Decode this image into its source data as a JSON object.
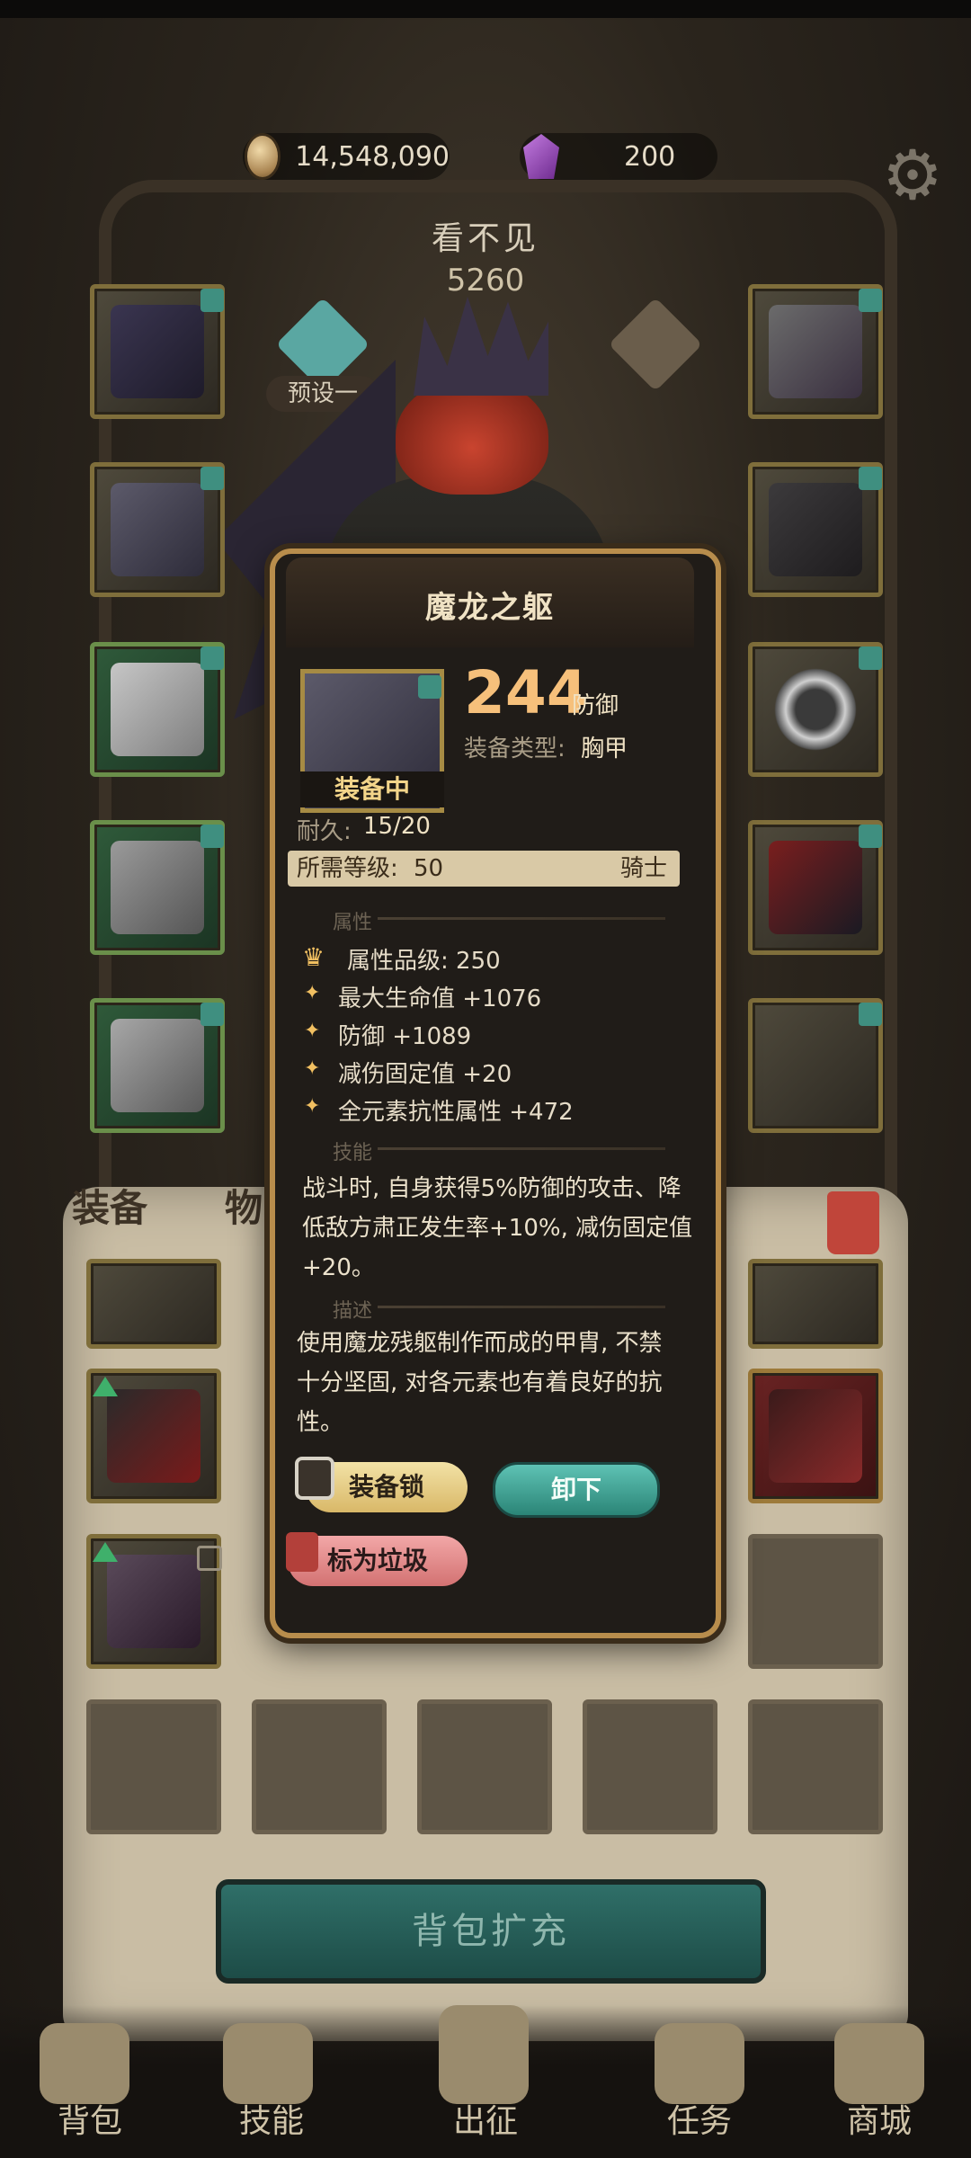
{
  "currency": {
    "coins": "14,548,090",
    "gems": "200"
  },
  "hero": {
    "name": "看不见",
    "power": "5260",
    "preset": "预设一"
  },
  "tabs": {
    "equipment": "装备",
    "items": "物品"
  },
  "item": {
    "title": "魔龙之躯",
    "equipped_label": "装备中",
    "main_value": "244",
    "main_stat": "防御",
    "type_label": "装备类型:",
    "type_value": "胸甲",
    "durability_label": "耐久:",
    "durability_value": "15/20",
    "required_level_label": "所需等级:",
    "required_level_value": "50",
    "class": "骑士",
    "section_attributes": "属性",
    "attributes": [
      "属性品级: 250",
      "最大生命值 +1076",
      "防御 +1089",
      "减伤固定值 +20",
      "全元素抗性属性 +472"
    ],
    "section_skill": "技能",
    "skill_lines": [
      "战斗时, 自身获得5%防御的攻击、降",
      "低敌方肃正发生率+10%, 减伤固定值",
      "+20。"
    ],
    "section_desc": "描述",
    "desc_lines": [
      "使用魔龙残躯制作而成的甲胄, 不禁",
      "十分坚固, 对各元素也有着良好的抗",
      "性。"
    ],
    "lock_button": "装备锁",
    "unequip_button": "卸下",
    "junk_button": "标为垃圾"
  },
  "expand_button": "背包扩充",
  "nav": [
    "背包",
    "技能",
    "出征",
    "任务",
    "商城"
  ],
  "colors": {
    "accent_gold": "#b88d4c",
    "teal": "#2b8577",
    "number_orange": "#f6c07b"
  }
}
